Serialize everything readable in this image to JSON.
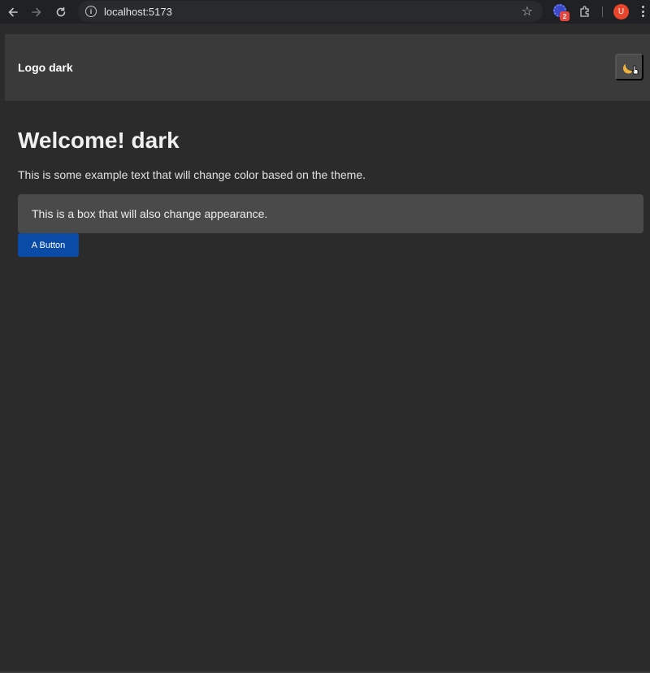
{
  "browser": {
    "url": "localhost:5173",
    "icons": {
      "back": "arrow-left-icon",
      "forward": "arrow-right-icon",
      "reload": "reload-icon",
      "site_info": "info-icon",
      "bookmark": "star-icon",
      "extension": "extension-gear-icon",
      "extensions_menu": "puzzle-icon",
      "menu": "kebab-icon"
    },
    "extension_badge": "2",
    "profile_initial": "U"
  },
  "app": {
    "header": {
      "logo_text": "Logo dark",
      "theme_toggle_icon": "moon-icon"
    },
    "main": {
      "title": "Welcome! dark",
      "description": "This is some example text that will change color based on the theme.",
      "box_text": "This is a box that will also change appearance.",
      "button_label": "A Button"
    }
  },
  "colors": {
    "page_bg": "#2b2b2b",
    "header_bg": "#3a3a3a",
    "box_bg": "#4a4a4a",
    "button_bg": "#0a4ba8",
    "moon": "#f0b43c"
  }
}
